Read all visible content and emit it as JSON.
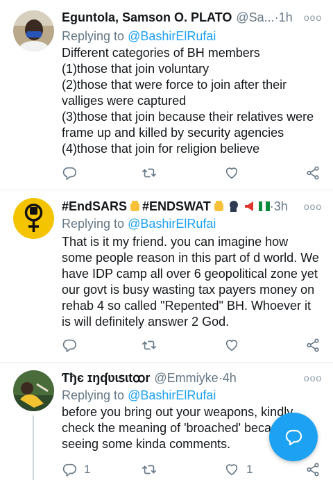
{
  "tweets": [
    {
      "name": "Eguntola, Samson O. PLATO",
      "handle": "@Sa...",
      "dot": " · ",
      "time": "1h",
      "more": "ooo",
      "replying_label": "Replying to ",
      "replying_to": "@BashirElRufai",
      "text": "Different categories of BH members\n(1)those that join voluntary\n(2)those that were force to join after their valliges  were captured\n(3)those that join because their relatives were frame up and killed by security agencies\n(4)those that join for religion believe",
      "reply_count": "",
      "retweet_count": "",
      "like_count": ""
    },
    {
      "name_part1": "#EndSARS",
      "name_part2": "#ENDSWAT",
      "dot": " · ",
      "time": "3h",
      "more": "ooo",
      "replying_label": "Replying to ",
      "replying_to": "@BashirElRufai",
      "text": "That is it my friend. you can imagine how some people reason in this part of d world. We have IDP camp all over 6 geopolitical zone yet our govt is busy wasting tax payers money on rehab 4 so called \"Repented\" BH. Whoever it is will definitely answer 2 God.",
      "reply_count": "",
      "retweet_count": "",
      "like_count": ""
    },
    {
      "name": "Ƭђє ɪŋʠʋɩꜱɩtꝏr",
      "handle": "@Emmiyke",
      "dot": " · ",
      "time": "4h",
      "more": "ooo",
      "replying_label": "Replying to ",
      "replying_to": "@BashirElRufai",
      "text": "before you bring out your weapons, kindly check the meaning of 'broached' becau seeing some kinda comments.",
      "reply_count": "1",
      "retweet_count": "",
      "like_count": "1"
    }
  ],
  "icons": {
    "reply": "reply-icon",
    "retweet": "retweet-icon",
    "like": "heart-icon",
    "share": "share-icon",
    "compose": "compose-reply-icon",
    "avatar2": "feminist-fist-icon"
  },
  "colors": {
    "accent": "#1da1f2",
    "secondary_text": "#657786",
    "divider": "#e6ecf0",
    "avatar2_bg": "#f5c400"
  }
}
